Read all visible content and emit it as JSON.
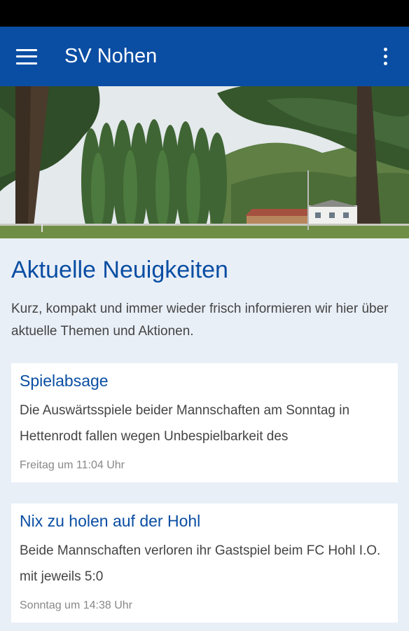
{
  "app_bar": {
    "title": "SV Nohen",
    "menu_icon": "hamburger-menu-icon",
    "more_icon": "more-vert-icon"
  },
  "hero": {
    "image": "sports-field-photo"
  },
  "section": {
    "title": "Aktuelle Neuigkeiten",
    "intro": "Kurz, kompakt und immer wieder frisch informieren wir hier über aktuelle Themen und Aktionen."
  },
  "news": [
    {
      "title": "Spielabsage",
      "text": "Die Auswärtsspiele beider Mannschaften am Sonntag in Hettenrodt fallen wegen Unbespielbarkeit des",
      "date": "Freitag um 11:04 Uhr"
    },
    {
      "title": "Nix zu holen auf der Hohl",
      "text": "Beide Mannschaften verloren ihr Gastspiel beim FC Hohl I.O. mit jeweils 5:0",
      "date": "Sonntag um 14:38 Uhr"
    }
  ],
  "colors": {
    "primary": "#0a4ea3",
    "background": "#e9eff7",
    "card": "#ffffff"
  }
}
